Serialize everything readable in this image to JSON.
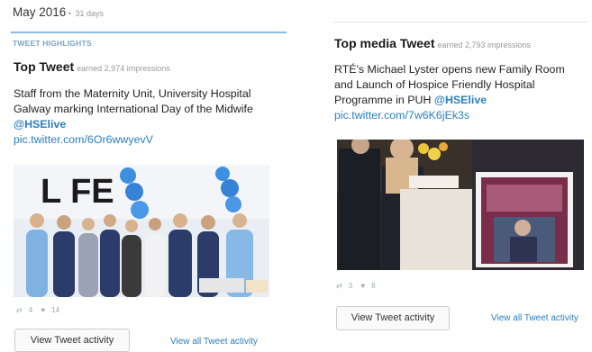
{
  "left": {
    "month": "May 2016",
    "month_sep": " • ",
    "days": "31 days",
    "highlights_label": "TWEET HIGHLIGHTS",
    "title": "Top Tweet",
    "earned": "earned 2,974 impressions",
    "text": "Staff from the Maternity Unit, University Hospital Galway marking International Day of the Midwife",
    "handle": "@HSElive",
    "link": "pic.twitter.com/6Or6wwyevV",
    "photo_sign": "L  FE",
    "retweets": "4",
    "likes": "14",
    "button": "View Tweet activity",
    "view_all": "View all Tweet activity"
  },
  "right": {
    "title": "Top media Tweet",
    "earned": "earned 2,793 impressions",
    "text": "RTÉ's Michael Lyster opens new Family Room and Launch of Hospice Friendly Hospital Programme in PUH",
    "handle": "@HSElive",
    "link": "pic.twitter.com/7w6K6jEk3s",
    "retweets": "3",
    "likes": "8",
    "button": "View Tweet activity",
    "view_all": "View all Tweet activity"
  },
  "colors": {
    "link": "#2a7fc0",
    "highlight_line": "#8bb9e0",
    "muted": "#999999"
  },
  "icons": [
    "retweet-icon",
    "heart-icon"
  ]
}
